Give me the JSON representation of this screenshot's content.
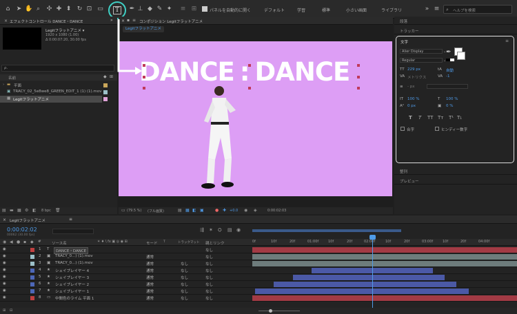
{
  "toolbar": {
    "align_label": "パネルを自動的に開く",
    "workspaces": [
      "デフォルト",
      "学習",
      "標準",
      "小さい画面",
      "ライブラリ"
    ],
    "search_placeholder": "ヘルプを検索"
  },
  "project": {
    "tab_label": "エフェクトコントロール DANCE・DANCE",
    "comp_name": "Legitフラットアニメ ▾",
    "comp_info_1": "1920 x 1080 (1.00)",
    "comp_info_2": "Δ 0:00:07:20, 30.00 fps",
    "search_placeholder": "ρ.",
    "col_name": "名前",
    "items": [
      {
        "name": "平面",
        "type": "folder"
      },
      {
        "name": "TRACY_02_5e8we8_GREEN_EDIT_1 (1) (1).mov",
        "type": "footage"
      },
      {
        "name": "Legitフラットアニメ",
        "type": "comp"
      }
    ],
    "bpc": "8 bpc"
  },
  "comp_viewer": {
    "tab_label": "コンポジション Legitフラットアニメ",
    "breadcrumb": "Legitフラットアニメ",
    "title_text_1": "DANCE",
    "title_sep": ":",
    "title_text_2": "DANCE",
    "zoom": "(79.5 %)",
    "resolution": "(フル画質)",
    "timecode": "0:00:02:03",
    "exposure": "+0.0",
    "bg_color": "#dd9ef5"
  },
  "right_panel": {
    "info_label": "段落",
    "tracker_label": "トラッカー",
    "character_label": "文字",
    "font_name": "Alier Display",
    "font_style": "Regular",
    "font_size": "229 px",
    "leading": "自動",
    "kerning": "メトリクス",
    "tracking": "-1",
    "stroke": "- px",
    "vscale": "100 %",
    "hscale": "100 %",
    "baseline": "0 px",
    "tsume": "0 %",
    "style_buttons": [
      "T",
      "T",
      "TT",
      "Tт",
      "T¹",
      "T₁"
    ],
    "ligature": "合字",
    "hindi": "ヒンディー数字",
    "align_label": "整列",
    "preview_label": "プレビュー"
  },
  "timeline": {
    "tab_label": "Legitフラットアニメ",
    "timecode": "0:00:02:02",
    "timecode_sub": "00062 (30.00 fps)",
    "col_source": "ソース名",
    "col_mode": "モード",
    "col_trkmat": "トラックマット",
    "col_parent": "親とリンク",
    "ruler": [
      "0f",
      "10f",
      "20f",
      "01:00f",
      "10f",
      "20f",
      "02:00f",
      "10f",
      "20f",
      "03:00f",
      "10f",
      "20f",
      "04:00f"
    ],
    "layers": [
      {
        "num": "1",
        "icon": "T",
        "name": "DANCE・DANCE",
        "color": "#c04040",
        "mode": "",
        "trk": "",
        "parent": "なし",
        "bar_color": "#a23a44"
      },
      {
        "num": "2",
        "icon": "▣",
        "name": "TRACY_0...) (1).mov",
        "color": "#9cc0c8",
        "mode": "通常",
        "trk": "",
        "parent": "なし",
        "bar_color": "#6e7c7c"
      },
      {
        "num": "3",
        "icon": "▣",
        "name": "TRACY_0...) (1).mov",
        "color": "#9cc0c8",
        "mode": "通常",
        "trk": "なし",
        "parent": "なし",
        "bar_color": "#6e7c7c"
      },
      {
        "num": "4",
        "icon": "★",
        "name": "シェイプレイヤー 4",
        "color": "#4d67b8",
        "mode": "通常",
        "trk": "なし",
        "parent": "なし",
        "bar_color": "#4b59a6"
      },
      {
        "num": "5",
        "icon": "★",
        "name": "シェイプレイヤー 3",
        "color": "#4d67b8",
        "mode": "通常",
        "trk": "なし",
        "parent": "なし",
        "bar_color": "#4b59a6"
      },
      {
        "num": "6",
        "icon": "★",
        "name": "シェイプレイヤー 2",
        "color": "#4d67b8",
        "mode": "通常",
        "trk": "なし",
        "parent": "なし",
        "bar_color": "#4b59a6"
      },
      {
        "num": "7",
        "icon": "★",
        "name": "シェイプレイヤー 1",
        "color": "#4d67b8",
        "mode": "通常",
        "trk": "なし",
        "parent": "なし",
        "bar_color": "#4b59a6"
      },
      {
        "num": "8",
        "icon": "▭",
        "name": "中間色のライム 平面 1",
        "color": "#c04040",
        "mode": "通常",
        "trk": "なし",
        "parent": "なし",
        "bar_color": "#a23a44"
      }
    ]
  }
}
